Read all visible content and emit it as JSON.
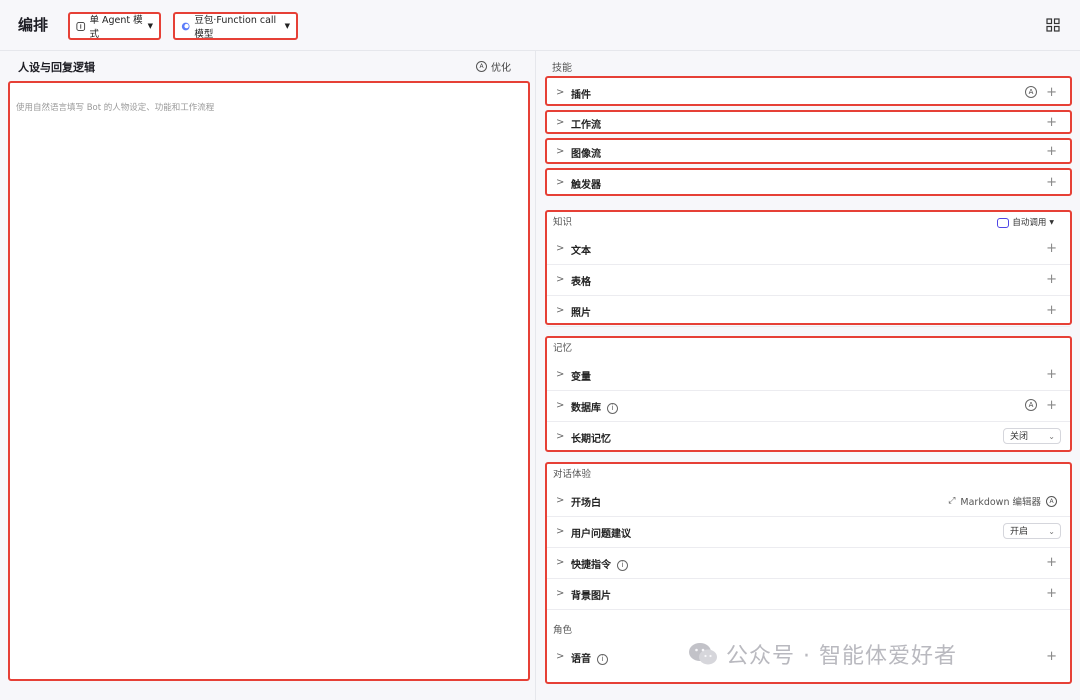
{
  "header": {
    "title": "编排",
    "mode_label": "单 Agent 模式",
    "model_label": "豆包·Function call模型"
  },
  "left": {
    "title": "人设与回复逻辑",
    "optimize_label": "优化",
    "editor_placeholder": "使用自然语言填写 Bot 的人物设定、功能和工作流程"
  },
  "skills": {
    "label": "技能",
    "plugin": "插件",
    "workflow": "工作流",
    "imageflow": "图像流",
    "trigger": "触发器"
  },
  "knowledge": {
    "label": "知识",
    "auto_call": "自动调用",
    "items": [
      "文本",
      "表格",
      "照片"
    ]
  },
  "memory": {
    "label": "记忆",
    "variable": "变量",
    "database": "数据库",
    "longterm": "长期记忆",
    "longterm_value": "关闭"
  },
  "dialog": {
    "label": "对话体验",
    "opening": "开场白",
    "markdown_editor": "Markdown 编辑器",
    "suggestion": "用户问题建议",
    "suggestion_value": "开启",
    "shortcut": "快捷指令",
    "background": "背景图片"
  },
  "role": {
    "label": "角色",
    "voice": "语音"
  },
  "watermark": "公众号 · 智能体爱好者",
  "colors": {
    "highlight": "#e64036",
    "background": "#f7f7fa"
  }
}
